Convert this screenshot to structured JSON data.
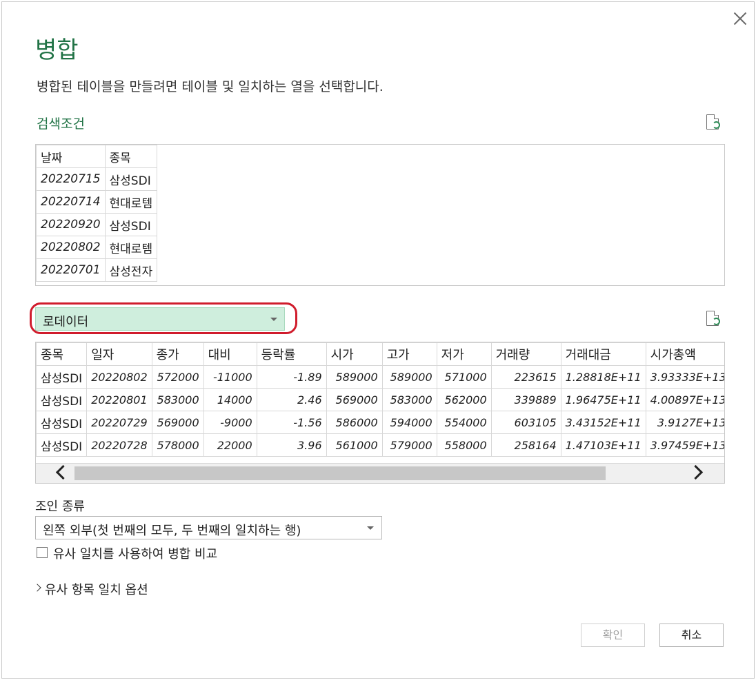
{
  "dialog": {
    "title": "병합",
    "description": "병합된 테이블을 만들려면 테이블 및 일치하는 열을 선택합니다.",
    "close_icon": "close-icon"
  },
  "first_table": {
    "name": "검색조건",
    "columns": [
      "날짜",
      "종목"
    ],
    "rows": [
      [
        "20220715",
        "삼성SDI"
      ],
      [
        "20220714",
        "현대로템"
      ],
      [
        "20220920",
        "삼성SDI"
      ],
      [
        "20220802",
        "현대로템"
      ],
      [
        "20220701",
        "삼성전자"
      ]
    ]
  },
  "second_table": {
    "selected": "로데이터",
    "columns": [
      "종목",
      "일자",
      "종가",
      "대비",
      "등락률",
      "시가",
      "고가",
      "저가",
      "거래량",
      "거래대금",
      "시가총액"
    ],
    "rows": [
      [
        "삼성SDI",
        "20220802",
        "572000",
        "-11000",
        "-1.89",
        "589000",
        "589000",
        "571000",
        "223615",
        "1.28818E+11",
        "3.93333E+13"
      ],
      [
        "삼성SDI",
        "20220801",
        "583000",
        "14000",
        "2.46",
        "569000",
        "583000",
        "562000",
        "339889",
        "1.96475E+11",
        "4.00897E+13"
      ],
      [
        "삼성SDI",
        "20220729",
        "569000",
        "-9000",
        "-1.56",
        "586000",
        "594000",
        "554000",
        "603105",
        "3.43152E+11",
        "3.9127E+13"
      ],
      [
        "삼성SDI",
        "20220728",
        "578000",
        "22000",
        "3.96",
        "561000",
        "579000",
        "558000",
        "258164",
        "1.47103E+11",
        "3.97459E+13"
      ]
    ]
  },
  "join": {
    "label": "조인 종류",
    "selected": "왼쪽 외부(첫 번째의 모두, 두 번째의 일치하는 행)",
    "fuzzy_checkbox_label": "유사 일치를 사용하여 병합 비교",
    "fuzzy_options_label": "유사 항목 일치 옵션"
  },
  "buttons": {
    "ok": "확인",
    "cancel": "취소"
  },
  "colors": {
    "accent": "#217346",
    "selected_bg": "#cfeedd",
    "annotation": "#d01c2c"
  }
}
